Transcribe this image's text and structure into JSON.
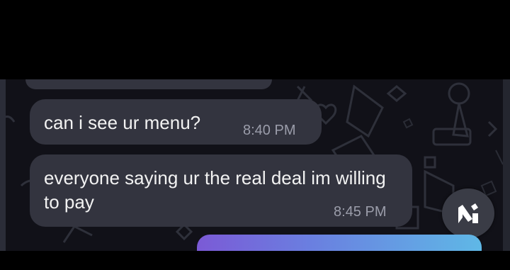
{
  "messages": [
    {
      "text": "can i see ur menu?",
      "time": "8:40 PM"
    },
    {
      "text": "everyone saying ur the real deal im willing to pay",
      "time": "8:45 PM"
    }
  ],
  "fab": {
    "icon": "app-logo-icon"
  },
  "colors": {
    "background": "#111118",
    "bubble": "#33343f",
    "bubble_text": "#f2f2f2",
    "timestamp": "#9b9daa",
    "compose_gradient_start": "#7b5ad6",
    "compose_gradient_end": "#5fb8e6"
  }
}
